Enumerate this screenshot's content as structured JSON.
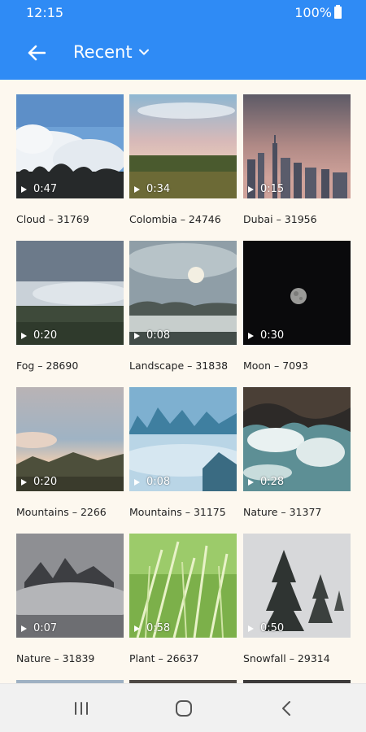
{
  "status_bar": {
    "time": "12:15",
    "battery": "100%"
  },
  "app_bar": {
    "title": "Recent"
  },
  "videos": [
    {
      "caption": "Cloud – 31769",
      "duration": "0:47"
    },
    {
      "caption": "Colombia – 24746",
      "duration": "0:34"
    },
    {
      "caption": "Dubai – 31956",
      "duration": "0:15"
    },
    {
      "caption": "Fog – 28690",
      "duration": "0:20"
    },
    {
      "caption": "Landscape – 31838",
      "duration": "0:08"
    },
    {
      "caption": "Moon – 7093",
      "duration": "0:30"
    },
    {
      "caption": "Mountains – 2266",
      "duration": "0:20"
    },
    {
      "caption": "Mountains – 31175",
      "duration": "0:08"
    },
    {
      "caption": "Nature – 31377",
      "duration": "0:28"
    },
    {
      "caption": "Nature – 31839",
      "duration": "0:07"
    },
    {
      "caption": "Plant – 26637",
      "duration": "0:58"
    },
    {
      "caption": "Snowfall – 29314",
      "duration": "0:50"
    }
  ],
  "colors": {
    "app_bar": "#2f8bf5",
    "background": "#fdf8ef",
    "nav_bar": "#f1f1f1"
  },
  "icons": {
    "back": "arrow-left-icon",
    "dropdown": "chevron-down-icon",
    "play": "play-icon",
    "recents": "recent-apps-icon",
    "home": "home-icon",
    "nav_back": "back-chevron-icon"
  }
}
